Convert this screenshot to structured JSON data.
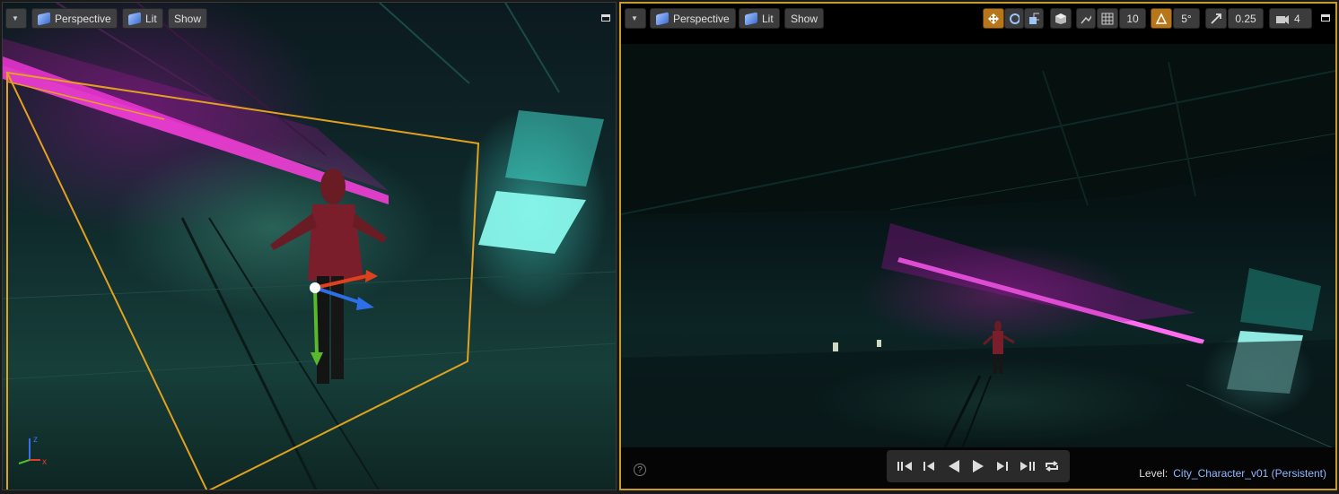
{
  "left_viewport": {
    "view_mode": "Perspective",
    "lighting": "Lit",
    "show": "Show"
  },
  "right_viewport": {
    "view_mode": "Perspective",
    "lighting": "Lit",
    "show": "Show",
    "grid_snap_value": "10",
    "rotation_snap_value": "5°",
    "scale_snap_value": "0.25",
    "camera_speed": "4",
    "level_label": "Level:",
    "level_name": "City_Character_v01 (Persistent)"
  },
  "axis_labels": {
    "x": "x",
    "z": "z"
  },
  "help_glyph": "?",
  "colors": {
    "selection": "#e3a11e",
    "active_border": "#c79a2a",
    "accent_orange": "#b8761a",
    "neon_magenta": "#ff4ee6",
    "neon_cyan": "#7ff9ee"
  }
}
